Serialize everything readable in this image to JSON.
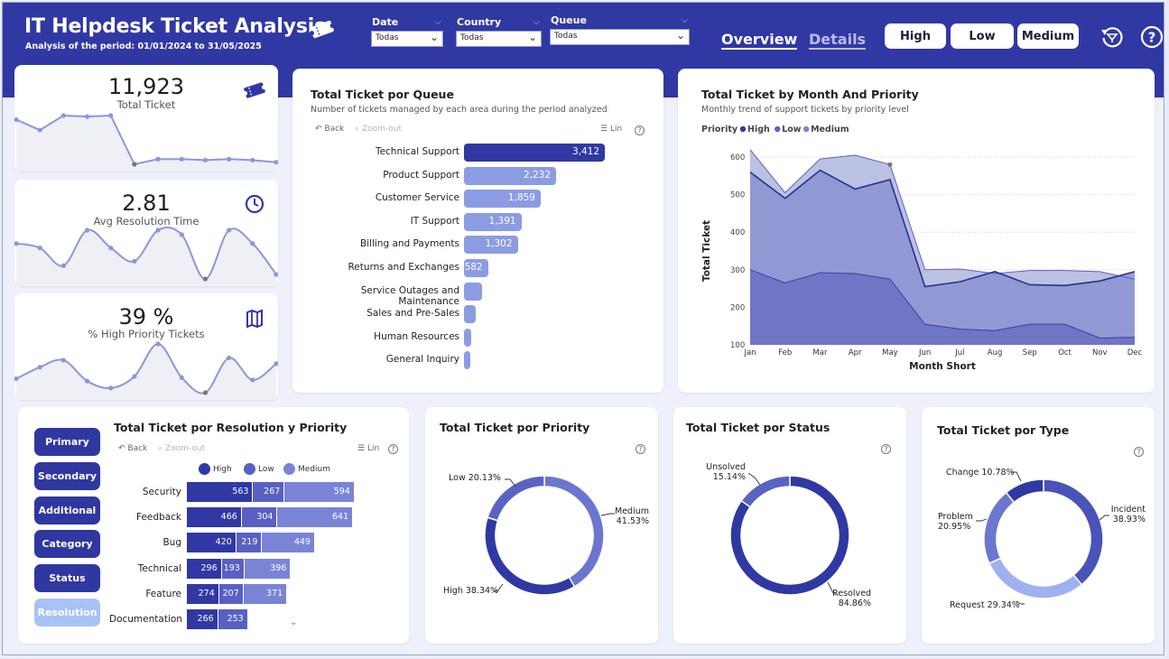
{
  "header": {
    "title": "IT Helpdesk Ticket Analysis",
    "subtitle": "Analysis of the period: 01/01/2024 to 31/05/2025",
    "filters": [
      {
        "label": "Date",
        "value": "Todas"
      },
      {
        "label": "Country",
        "value": "Todas"
      },
      {
        "label": "Queue",
        "value": "Todas"
      }
    ],
    "tabs": [
      {
        "label": "Overview",
        "active": true
      },
      {
        "label": "Details",
        "active": false
      }
    ],
    "priority_buttons": [
      "High",
      "Low",
      "Medium"
    ],
    "icons": [
      "ticket-icon",
      "reset-filter-icon",
      "help-icon"
    ]
  },
  "kpis": [
    {
      "value": "11,923",
      "label": "Total Ticket",
      "icon": "ticket-icon"
    },
    {
      "value": "2.81",
      "label": "Avg Resolution Time",
      "icon": "clock-icon"
    },
    {
      "value": "39 %",
      "label": "% High Priority Tickets",
      "icon": "map-icon"
    }
  ],
  "queue_chart": {
    "title": "Total Ticket por Queue",
    "subtitle": "Number of tickets managed by each area during the period analyzed",
    "toolbar": {
      "back": "Back",
      "zoom": "Zoom-out",
      "lin": "Lin"
    },
    "colors": {
      "top": "#3038a3",
      "rest": "#8c9ce2"
    }
  },
  "month_chart": {
    "title": "Total Ticket by Month And Priority",
    "subtitle": "Monthly trend of support tickets by priority level",
    "legend_title": "Priority",
    "colors": {
      "High": "#3038a3",
      "Low": "#5a63c3",
      "Medium": "#7a84d4"
    }
  },
  "resolution_chart": {
    "title": "Total Ticket por Resolution y Priority",
    "toolbar": {
      "back": "Back",
      "zoom": "Zoom-out",
      "lin": "Lin"
    },
    "side_buttons": [
      {
        "label": "Primary",
        "active": false
      },
      {
        "label": "Secondary",
        "active": false
      },
      {
        "label": "Additional",
        "active": false
      },
      {
        "label": "Category",
        "active": false
      },
      {
        "label": "Status",
        "active": false
      },
      {
        "label": "Resolution",
        "active": true
      }
    ],
    "colors": {
      "High": "#3038a3",
      "Low": "#5960c4",
      "Medium": "#7a84d6"
    }
  },
  "donuts": [
    {
      "title": "Total Ticket por Priority"
    },
    {
      "title": "Total Ticket por Status"
    },
    {
      "title": "Total Ticket por Type"
    }
  ],
  "chart_data": [
    {
      "type": "line",
      "title": "",
      "x": [
        "Jan",
        "Feb",
        "Mar",
        "Apr",
        "May",
        "Jun",
        "Jul",
        "Aug",
        "Sep",
        "Oct",
        "Nov",
        "Dec"
      ],
      "series": [
        {
          "name": "Total Ticket",
          "values": [
            1150,
            1050,
            1190,
            1180,
            1190,
            720,
            770,
            770,
            760,
            770,
            760,
            740
          ]
        }
      ]
    },
    {
      "type": "line",
      "title": "",
      "x": [
        "Jan",
        "Feb",
        "Mar",
        "Apr",
        "May",
        "Jun",
        "Jul",
        "Aug",
        "Sep",
        "Oct",
        "Nov",
        "Dec"
      ],
      "series": [
        {
          "name": "Avg Resolution Time",
          "values": [
            2.83,
            2.82,
            2.78,
            2.86,
            2.82,
            2.79,
            2.86,
            2.85,
            2.75,
            2.86,
            2.83,
            2.76
          ]
        }
      ]
    },
    {
      "type": "line",
      "title": "",
      "x": [
        "Jan",
        "Feb",
        "Mar",
        "Apr",
        "May",
        "Jun",
        "Jul",
        "Aug",
        "Sep",
        "Oct",
        "Nov",
        "Dec"
      ],
      "series": [
        {
          "name": "% High Priority Tickets",
          "values": [
            38.2,
            39.2,
            39.8,
            38.0,
            37.4,
            38.4,
            41.2,
            38.3,
            37.0,
            40.0,
            38.1,
            39.5
          ]
        }
      ]
    },
    {
      "type": "bar",
      "title": "Total Ticket por Queue",
      "categories": [
        "Technical Support",
        "Product Support",
        "Customer Service",
        "IT Support",
        "Billing and Payments",
        "Returns and Exchanges",
        "Service Outages and Maintenance",
        "Sales and Pre-Sales",
        "Human Resources",
        "General Inquiry"
      ],
      "values": [
        3412,
        2232,
        1859,
        1391,
        1302,
        582,
        430,
        290,
        180,
        150
      ],
      "labels": [
        "3,412",
        "2,232",
        "1,859",
        "1,391",
        "1,302",
        "582",
        "",
        "",
        "",
        ""
      ],
      "xlim": [
        0,
        3412
      ]
    },
    {
      "type": "area",
      "title": "Total Ticket by Month And Priority",
      "xlabel": "Month Short",
      "ylabel": "Total Ticket",
      "x": [
        "Jan",
        "Feb",
        "Mar",
        "Apr",
        "May",
        "Jun",
        "Jul",
        "Aug",
        "Sep",
        "Oct",
        "Nov",
        "Dec"
      ],
      "ylim": [
        100,
        640
      ],
      "yticks": [
        100,
        200,
        300,
        400,
        500,
        600
      ],
      "series": [
        {
          "name": "High",
          "values": [
            560,
            490,
            565,
            515,
            540,
            255,
            268,
            295,
            260,
            258,
            270,
            295
          ]
        },
        {
          "name": "Low",
          "values": [
            300,
            265,
            292,
            290,
            275,
            155,
            142,
            138,
            155,
            155,
            118,
            120
          ]
        },
        {
          "name": "Medium",
          "values": [
            620,
            505,
            595,
            605,
            580,
            300,
            302,
            290,
            298,
            298,
            295,
            275
          ]
        }
      ],
      "grid": true,
      "legend": "top-left"
    },
    {
      "type": "bar",
      "title": "Total Ticket por Resolution y Priority",
      "categories": [
        "Security",
        "Feedback",
        "Bug",
        "Technical",
        "Feature",
        "Documentation"
      ],
      "series": [
        {
          "name": "High",
          "values": [
            563,
            466,
            420,
            296,
            274,
            266
          ]
        },
        {
          "name": "Low",
          "values": [
            267,
            304,
            219,
            193,
            207,
            253
          ]
        },
        {
          "name": "Medium",
          "values": [
            594,
            641,
            449,
            396,
            371,
            0
          ]
        }
      ],
      "stacked": true,
      "legend": "top"
    },
    {
      "type": "pie",
      "title": "Total Ticket por Priority",
      "categories": [
        "Medium",
        "High",
        "Low"
      ],
      "values": [
        41.53,
        38.34,
        20.13
      ],
      "labels": [
        "Medium 41.53%",
        "High 38.34%",
        "Low 20.13%"
      ],
      "colors": [
        "#6d76cf",
        "#3038a3",
        "#5a63c3"
      ]
    },
    {
      "type": "pie",
      "title": "Total Ticket por Status",
      "categories": [
        "Resolved",
        "Unsolved"
      ],
      "values": [
        84.86,
        15.14
      ],
      "labels": [
        "Resolved 84.86%",
        "Unsolved 15.14%"
      ],
      "colors": [
        "#3038a3",
        "#5a63c3"
      ]
    },
    {
      "type": "pie",
      "title": "Total Ticket por Type",
      "categories": [
        "Incident",
        "Request",
        "Problem",
        "Change"
      ],
      "values": [
        38.93,
        29.34,
        20.95,
        10.78
      ],
      "labels": [
        "Incident 38.93%",
        "Request 29.34%",
        "Problem 20.95%",
        "Change 10.78%"
      ],
      "colors": [
        "#4a53b8",
        "#9fb1ee",
        "#6d76cf",
        "#3038a3"
      ]
    }
  ]
}
